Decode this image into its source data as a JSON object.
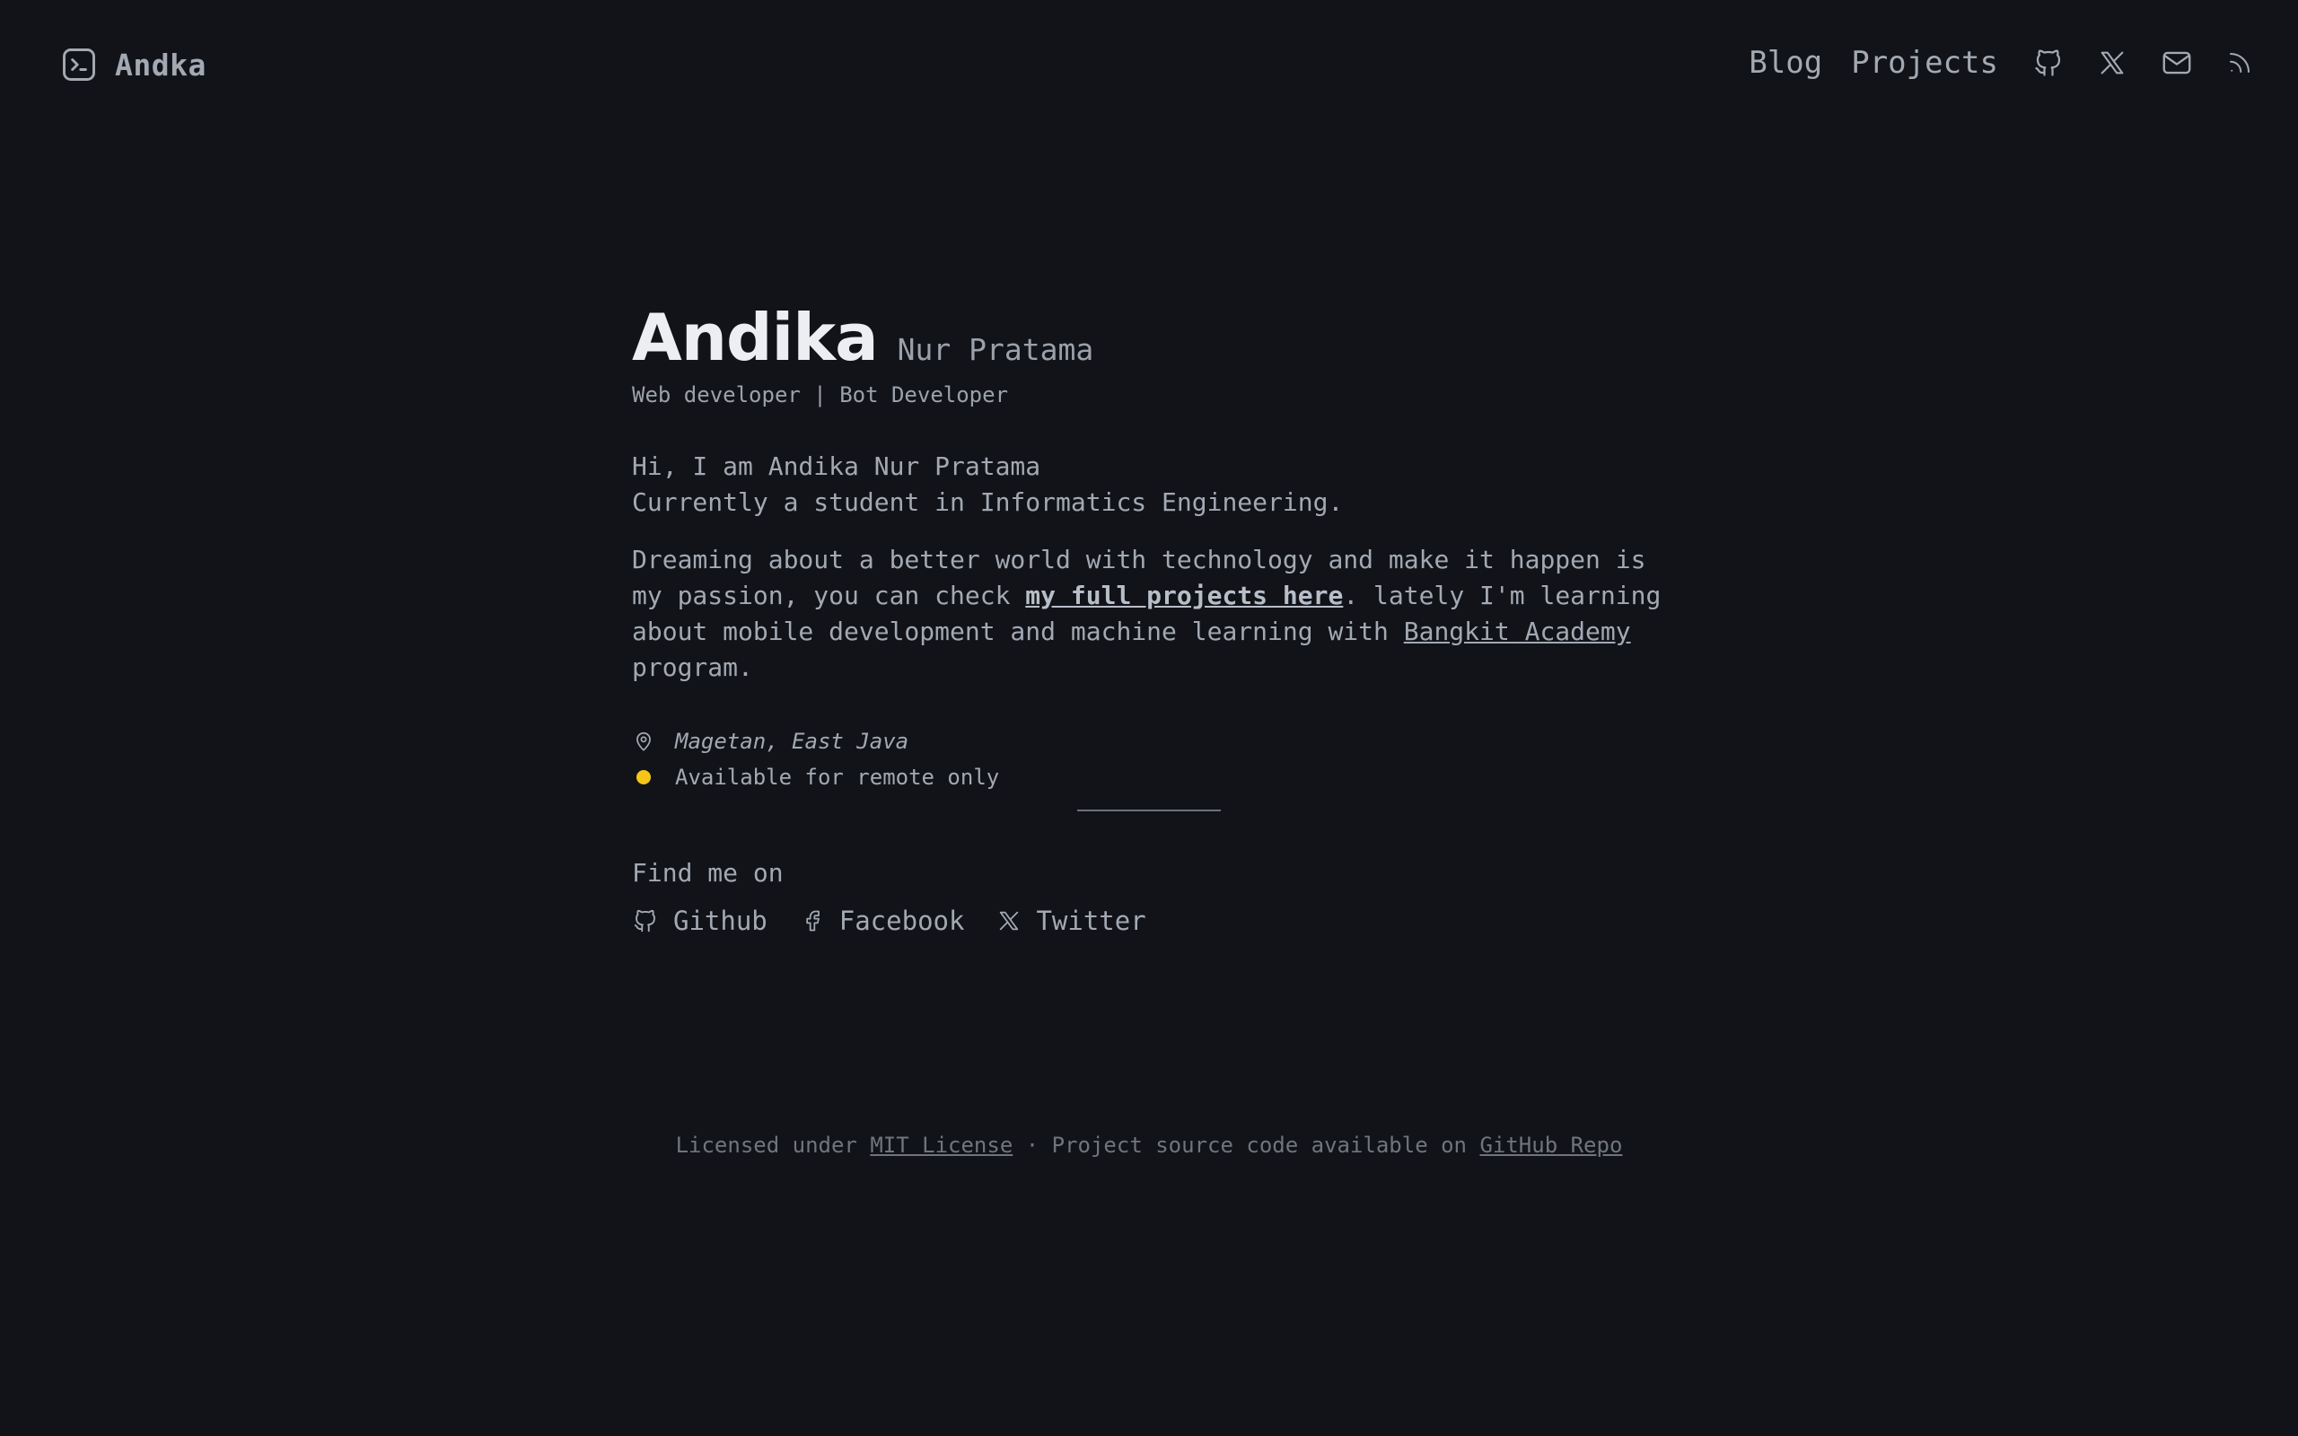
{
  "header": {
    "brand_name": "Andka",
    "nav": {
      "blog_label": "Blog",
      "projects_label": "Projects",
      "icons": [
        "github-icon",
        "x-icon",
        "mail-icon",
        "rss-icon"
      ]
    }
  },
  "hero": {
    "first_name": "Andika",
    "rest_name": "Nur Pratama",
    "role": "Web developer | Bot Developer"
  },
  "intro": {
    "line1": "Hi, I am Andika Nur Pratama",
    "line2": "Currently a student in Informatics Engineering."
  },
  "passion": {
    "text_before": "Dreaming about a better world with technology and make it happen is my passion, you can check ",
    "projects_link": "my full projects here",
    "text_middle": ". lately I'm learning about mobile development and machine learning with ",
    "academy_link": "Bangkit Academy",
    "text_after": " program."
  },
  "meta": {
    "location": "Magetan, East Java",
    "availability": "Available for remote only"
  },
  "social": {
    "heading": "Find me on",
    "github": "Github",
    "facebook": "Facebook",
    "twitter": "Twitter"
  },
  "footer": {
    "prefix": "Licensed under ",
    "license_link": "MIT License",
    "middle": " · Project source code available on ",
    "repo_link": "GitHub Repo"
  },
  "colors": {
    "background": "#111318",
    "text": "#a3a9b3",
    "heading": "#eceef1",
    "status_dot": "#f5c518"
  }
}
